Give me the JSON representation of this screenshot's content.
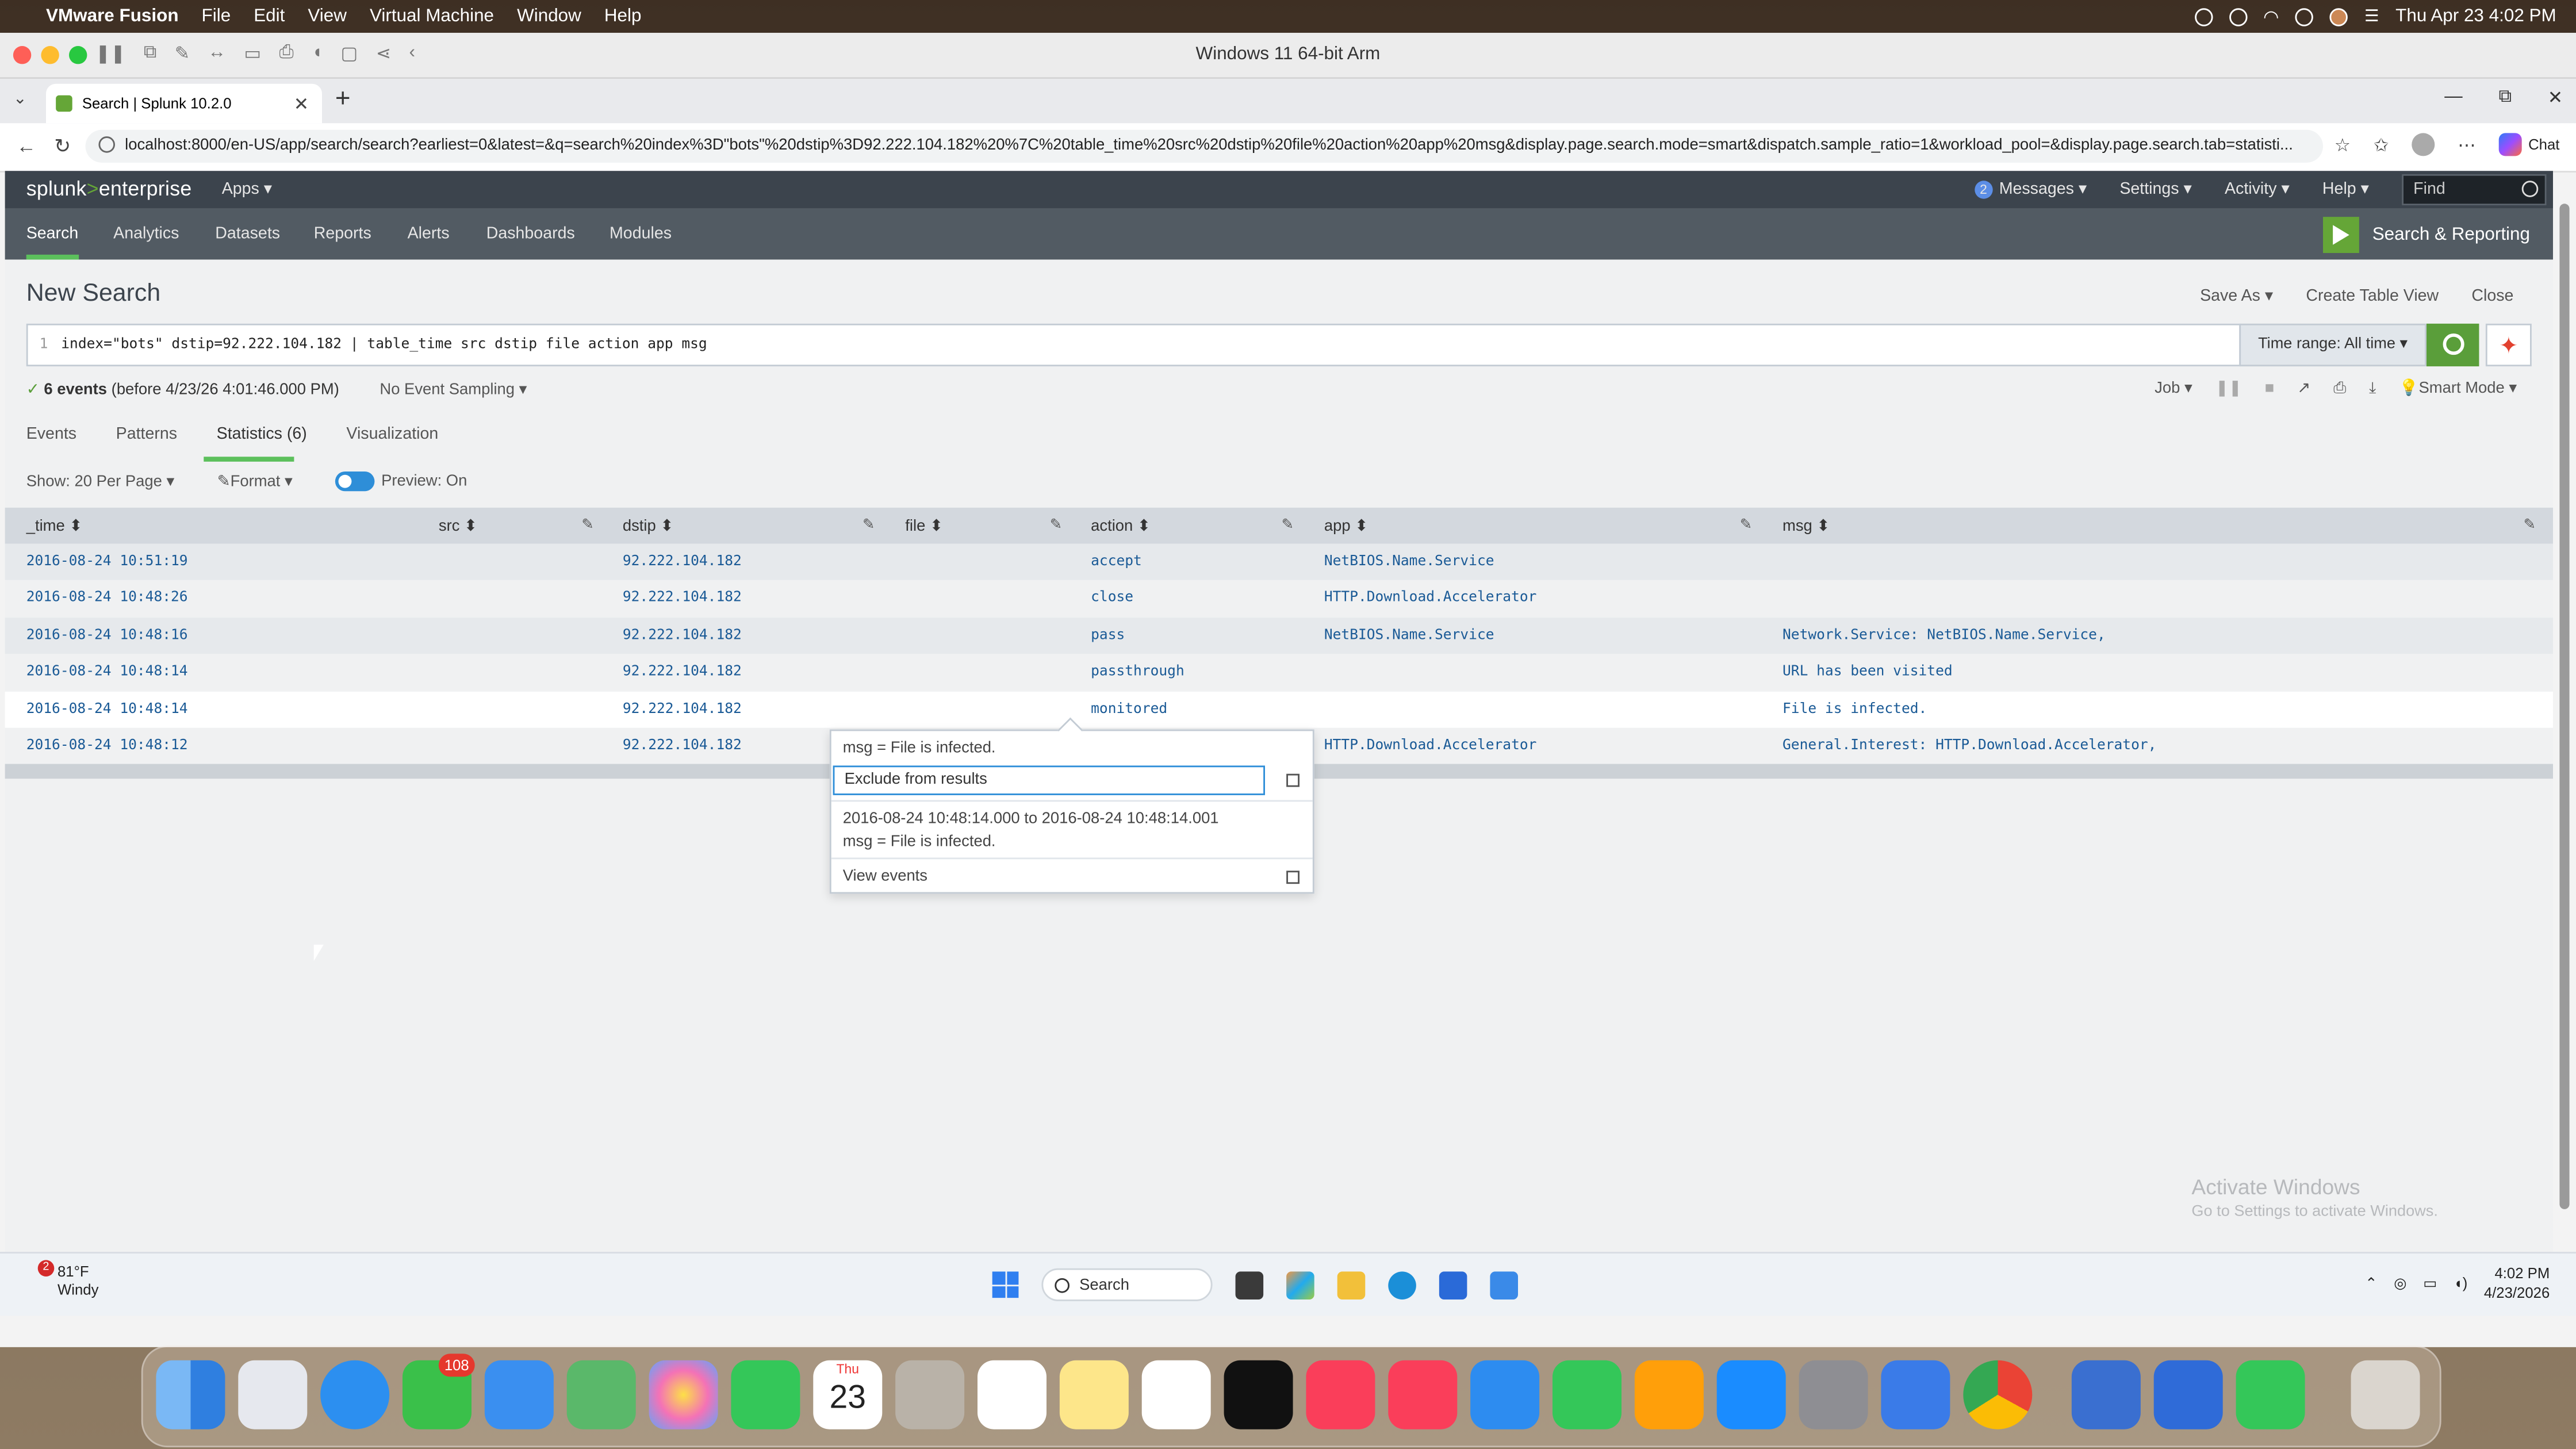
{
  "mac_menubar": {
    "app": "VMware Fusion",
    "menus": [
      "File",
      "Edit",
      "View",
      "Virtual Machine",
      "Window",
      "Help"
    ],
    "datetime": "Thu Apr 23  4:02 PM"
  },
  "vm_window": {
    "title": "Windows 11 64-bit Arm"
  },
  "browser": {
    "tab_title": "Search | Splunk 10.2.0",
    "url": "localhost:8000/en-US/app/search/search?earliest=0&latest=&q=search%20index%3D\"bots\"%20dstip%3D92.222.104.182%20%7C%20table_time%20src%20dstip%20file%20action%20app%20msg&display.page.search.mode=smart&dispatch.sample_ratio=1&workload_pool=&display.page.search.tab=statisti...",
    "chat_label": "Chat"
  },
  "splunk": {
    "logo_main": "splunk",
    "logo_gt": ">",
    "logo_product": "enterprise",
    "apps_label": "Apps ▾",
    "messages_count": "2",
    "messages_label": "Messages ▾",
    "settings_label": "Settings ▾",
    "activity_label": "Activity ▾",
    "help_label": "Help ▾",
    "find_placeholder": "Find",
    "nav": [
      "Search",
      "Analytics",
      "Datasets",
      "Reports",
      "Alerts",
      "Dashboards",
      "Modules"
    ],
    "app_name": "Search & Reporting",
    "page_title": "New Search",
    "save_as": "Save As ▾",
    "create_table_view": "Create Table View",
    "close": "Close",
    "query_line_no": "1",
    "query": "index=\"bots\" dstip=92.222.104.182 | table_time src dstip file action app msg",
    "time_range": "Time range: All time ▾",
    "status_check": "✓",
    "status_events": "6 events",
    "status_before": " (before 4/23/26 4:01:46.000 PM)",
    "sampling": "No Event Sampling ▾",
    "job_label": "Job ▾",
    "smart_mode": "Smart Mode ▾",
    "result_tabs": [
      "Events",
      "Patterns",
      "Statistics (6)",
      "Visualization"
    ],
    "show_per_page": "Show: 20 Per Page ▾",
    "format": "Format ▾",
    "preview": "Preview: On",
    "columns": [
      "_time ⬍",
      "src ⬍",
      "dstip ⬍",
      "file ⬍",
      "action ⬍",
      "app ⬍",
      "msg ⬍"
    ],
    "rows": [
      {
        "time": "2016-08-24 10:51:19",
        "src": "",
        "dstip": "92.222.104.182",
        "file": "",
        "action": "accept",
        "app": "NetBIOS.Name.Service",
        "msg": ""
      },
      {
        "time": "2016-08-24 10:48:26",
        "src": "",
        "dstip": "92.222.104.182",
        "file": "",
        "action": "close",
        "app": "HTTP.Download.Accelerator",
        "msg": ""
      },
      {
        "time": "2016-08-24 10:48:16",
        "src": "",
        "dstip": "92.222.104.182",
        "file": "",
        "action": "pass",
        "app": "NetBIOS.Name.Service",
        "msg": "Network.Service: NetBIOS.Name.Service,"
      },
      {
        "time": "2016-08-24 10:48:14",
        "src": "",
        "dstip": "92.222.104.182",
        "file": "",
        "action": "passthrough",
        "app": "",
        "msg": "URL has been visited"
      },
      {
        "time": "2016-08-24 10:48:14",
        "src": "",
        "dstip": "92.222.104.182",
        "file": "",
        "action": "monitored",
        "app": "",
        "msg": "File is infected."
      },
      {
        "time": "2016-08-24 10:48:12",
        "src": "",
        "dstip": "92.222.104.182",
        "file": "",
        "action": "",
        "app": "HTTP.Download.Accelerator",
        "msg": "General.Interest: HTTP.Download.Accelerator,"
      }
    ],
    "popup": {
      "field_value": "msg = File is infected.",
      "exclude": "Exclude from results",
      "time_range": "2016-08-24 10:48:14.000 to 2016-08-24 10:48:14.001",
      "field_value2": "msg = File is infected.",
      "view_events": "View events"
    },
    "watermark_title": "Activate Windows",
    "watermark_sub": "Go to Settings to activate Windows."
  },
  "windows_taskbar": {
    "weather_badge": "2",
    "temperature": "81°F",
    "condition": "Windy",
    "search_label": "Search",
    "time": "4:02 PM",
    "date": "4/23/2026"
  },
  "dock": {
    "messages_badge": "108",
    "calendar_month": "Thu",
    "calendar_day": "23"
  }
}
